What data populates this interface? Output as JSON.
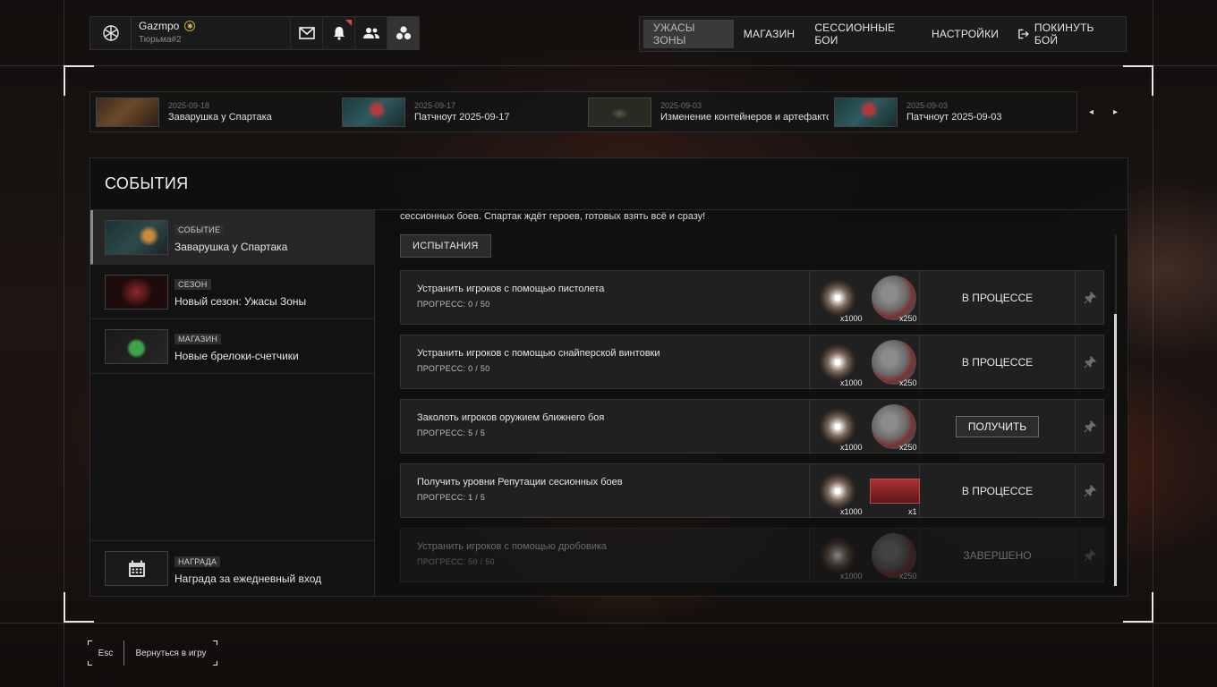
{
  "profile": {
    "username": "Gazmpo",
    "group": "Тюрьма#2"
  },
  "nav": {
    "items": [
      "УЖАСЫ ЗОНЫ",
      "МАГАЗИН",
      "СЕССИОННЫЕ БОИ",
      "НАСТРОЙКИ",
      "ПОКИНУТЬ БОЙ"
    ],
    "active_index": 0
  },
  "news": [
    {
      "date": "2025-09-18",
      "title": "Заварушка у Спартака"
    },
    {
      "date": "2025-09-17",
      "title": "Патчноут 2025-09-17"
    },
    {
      "date": "2025-09-03",
      "title": "Изменение контейнеров и артефакто..."
    },
    {
      "date": "2025-09-03",
      "title": "Патчноут 2025-09-03"
    }
  ],
  "events": {
    "title": "СОБЫТИЯ",
    "sidebar": [
      {
        "tag": "СОБЫТИЕ",
        "name": "Заварушка у Спартака"
      },
      {
        "tag": "СЕЗОН",
        "name": "Новый сезон: Ужасы Зоны"
      },
      {
        "tag": "МАГАЗИН",
        "name": "Новые брелоки-счетчики"
      }
    ],
    "reward": {
      "tag": "НАГРАДА",
      "name": "Награда за ежедневный вход"
    },
    "description": "сессионных боев. Спартак ждёт героев, готовых взять всё и сразу!",
    "tab_label": "ИСПЫТАНИЯ",
    "challenges": [
      {
        "title": "Устранить игроков с помощью пистолета",
        "progress": "ПРОГРЕСС: 0 / 50",
        "reward1_qty": "x1000",
        "reward2_qty": "x250",
        "reward2_kind": "seal",
        "status": "В ПРОЦЕССЕ",
        "state": "progress"
      },
      {
        "title": "Устранить игроков с помощью снайперской винтовки",
        "progress": "ПРОГРЕСС: 0 / 50",
        "reward1_qty": "x1000",
        "reward2_qty": "x250",
        "reward2_kind": "seal",
        "status": "В ПРОЦЕССЕ",
        "state": "progress"
      },
      {
        "title": "Заколоть игроков оружием ближнего боя",
        "progress": "ПРОГРЕСС: 5 / 5",
        "reward1_qty": "x1000",
        "reward2_qty": "x250",
        "reward2_kind": "seal",
        "status": "ПОЛУЧИТЬ",
        "state": "claim"
      },
      {
        "title": "Получить уровни Репутации сесионных боев",
        "progress": "ПРОГРЕСС: 1 / 5",
        "reward1_qty": "x1000",
        "reward2_qty": "x1",
        "reward2_kind": "crate",
        "status": "В ПРОЦЕССЕ",
        "state": "progress"
      },
      {
        "title": "Устранить игроков с помощью дробовика",
        "progress": "ПРОГРЕСС: 50 / 50",
        "reward1_qty": "x1000",
        "reward2_qty": "x250",
        "reward2_kind": "seal",
        "status": "ЗАВЕРШЕНО",
        "state": "done"
      }
    ]
  },
  "footer": {
    "key": "Esc",
    "label": "Вернуться в игру"
  },
  "colors": {
    "accent_gold": "#e2c25a",
    "notification": "#d94747",
    "crate_red": "#a93434"
  }
}
